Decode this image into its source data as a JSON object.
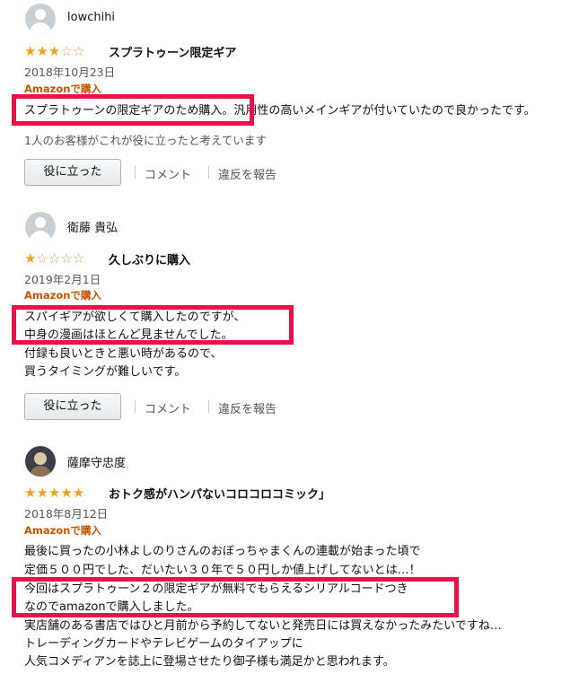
{
  "reviews": [
    {
      "name": "lowchihi",
      "rating": 3,
      "title": "スプラトゥーン限定ギア",
      "date": "2018年10月23日",
      "badge": "Amazonで購入",
      "body": "スプラトゥーンの限定ギアのため購入。汎用性の高いメインギアが付いていたので良かったです。",
      "helpful_count_text": "1人のお客様がこれが役に立ったと考えています",
      "helpful_button": "役に立った",
      "comment_link": "コメント",
      "report_link": "違反を報告"
    },
    {
      "name": "衛藤 貴弘",
      "rating": 1,
      "title": "久しぶりに購入",
      "date": "2019年2月1日",
      "badge": "Amazonで購入",
      "body_lines": [
        "スパイギアが欲しくて購入したのですが、",
        "中身の漫画はほとんど見ませんでした。",
        "付録も良いときと悪い時があるので、",
        "買うタイミングが難しいです。"
      ],
      "helpful_button": "役に立った",
      "comment_link": "コメント",
      "report_link": "違反を報告"
    },
    {
      "name": "薩摩守忠度",
      "rating": 5,
      "title": "おトク感がハンパないコロコロコミック」",
      "date": "2018年8月12日",
      "badge": "Amazonで購入",
      "body_lines": [
        "最後に買ったの小林よしのりさんのおぼっちゃまくんの連載が始まった頃で",
        "定価５００円でした、だいたい３０年で５０円しか値上げしてないとは…！",
        "今回はスプラトゥーン２の限定ギアが無料でもらえるシリアルコードつき",
        "なのでamazonで購入しました。",
        "実店舗のある書店ではひと月前から予約してないと発売日には買えなかったみたいですね…",
        "トレーディングカードやテレビゲームのタイアップに",
        "人気コメディアンを誌上に登場させたり御子様も満足かと思われます。"
      ]
    }
  ],
  "colors": {
    "highlight": "#e8124a",
    "star": "#f0a21b",
    "badge": "#c45500"
  }
}
